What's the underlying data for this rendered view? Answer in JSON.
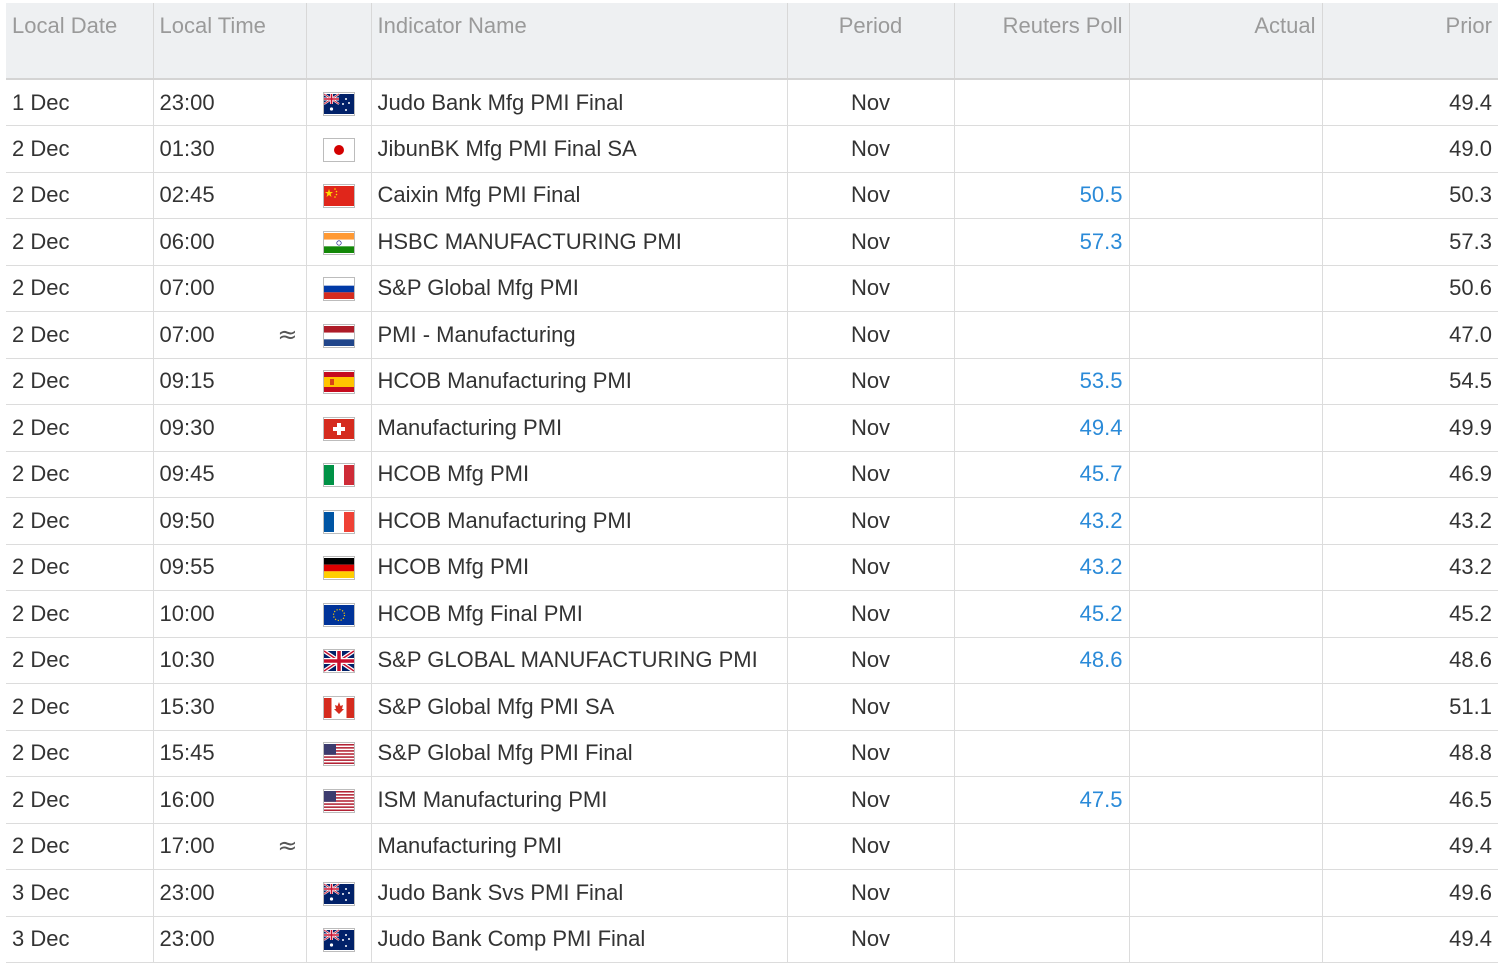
{
  "headers": {
    "date": "Local Date",
    "time": "Local Time",
    "flag": "",
    "name": "Indicator Name",
    "period": "Period",
    "poll": "Reuters Poll",
    "actual": "Actual",
    "prior": "Prior"
  },
  "colors": {
    "poll_value": "#2a8ad8",
    "header_bg": "#eef0f2",
    "header_text": "#9a9a9a"
  },
  "rows": [
    {
      "date": "1 Dec",
      "time": "23:00",
      "approx": "",
      "flag": "flag-australia-icon",
      "name": "Judo Bank Mfg PMI Final",
      "period": "Nov",
      "poll": "",
      "actual": "",
      "prior": "49.4"
    },
    {
      "date": "2 Dec",
      "time": "01:30",
      "approx": "",
      "flag": "flag-japan-icon",
      "name": "JibunBK Mfg PMI Final SA",
      "period": "Nov",
      "poll": "",
      "actual": "",
      "prior": "49.0"
    },
    {
      "date": "2 Dec",
      "time": "02:45",
      "approx": "",
      "flag": "flag-china-icon",
      "name": "Caixin Mfg PMI Final",
      "period": "Nov",
      "poll": "50.5",
      "actual": "",
      "prior": "50.3"
    },
    {
      "date": "2 Dec",
      "time": "06:00",
      "approx": "",
      "flag": "flag-india-icon",
      "name": "HSBC MANUFACTURING PMI",
      "period": "Nov",
      "poll": "57.3",
      "actual": "",
      "prior": "57.3"
    },
    {
      "date": "2 Dec",
      "time": "07:00",
      "approx": "",
      "flag": "flag-russia-icon",
      "name": "S&P Global Mfg PMI",
      "period": "Nov",
      "poll": "",
      "actual": "",
      "prior": "50.6"
    },
    {
      "date": "2 Dec",
      "time": "07:00",
      "approx": "≈",
      "flag": "flag-netherlands-icon",
      "name": "PMI - Manufacturing",
      "period": "Nov",
      "poll": "",
      "actual": "",
      "prior": "47.0"
    },
    {
      "date": "2 Dec",
      "time": "09:15",
      "approx": "",
      "flag": "flag-spain-icon",
      "name": "HCOB Manufacturing PMI",
      "period": "Nov",
      "poll": "53.5",
      "actual": "",
      "prior": "54.5"
    },
    {
      "date": "2 Dec",
      "time": "09:30",
      "approx": "",
      "flag": "flag-switzerland-icon",
      "name": "Manufacturing PMI",
      "period": "Nov",
      "poll": "49.4",
      "actual": "",
      "prior": "49.9"
    },
    {
      "date": "2 Dec",
      "time": "09:45",
      "approx": "",
      "flag": "flag-italy-icon",
      "name": "HCOB Mfg PMI",
      "period": "Nov",
      "poll": "45.7",
      "actual": "",
      "prior": "46.9"
    },
    {
      "date": "2 Dec",
      "time": "09:50",
      "approx": "",
      "flag": "flag-france-icon",
      "name": "HCOB Manufacturing PMI",
      "period": "Nov",
      "poll": "43.2",
      "actual": "",
      "prior": "43.2"
    },
    {
      "date": "2 Dec",
      "time": "09:55",
      "approx": "",
      "flag": "flag-germany-icon",
      "name": "HCOB Mfg PMI",
      "period": "Nov",
      "poll": "43.2",
      "actual": "",
      "prior": "43.2"
    },
    {
      "date": "2 Dec",
      "time": "10:00",
      "approx": "",
      "flag": "flag-eu-icon",
      "name": "HCOB Mfg Final PMI",
      "period": "Nov",
      "poll": "45.2",
      "actual": "",
      "prior": "45.2"
    },
    {
      "date": "2 Dec",
      "time": "10:30",
      "approx": "",
      "flag": "flag-uk-icon",
      "name": "S&P GLOBAL MANUFACTURING PMI",
      "period": "Nov",
      "poll": "48.6",
      "actual": "",
      "prior": "48.6"
    },
    {
      "date": "2 Dec",
      "time": "15:30",
      "approx": "",
      "flag": "flag-canada-icon",
      "name": "S&P Global Mfg PMI SA",
      "period": "Nov",
      "poll": "",
      "actual": "",
      "prior": "51.1"
    },
    {
      "date": "2 Dec",
      "time": "15:45",
      "approx": "",
      "flag": "flag-usa-icon",
      "name": "S&P Global Mfg PMI Final",
      "period": "Nov",
      "poll": "",
      "actual": "",
      "prior": "48.8"
    },
    {
      "date": "2 Dec",
      "time": "16:00",
      "approx": "",
      "flag": "flag-usa-icon",
      "name": "ISM Manufacturing PMI",
      "period": "Nov",
      "poll": "47.5",
      "actual": "",
      "prior": "46.5"
    },
    {
      "date": "2 Dec",
      "time": "17:00",
      "approx": "≈",
      "flag": "",
      "name": "Manufacturing PMI",
      "period": "Nov",
      "poll": "",
      "actual": "",
      "prior": "49.4"
    },
    {
      "date": "3 Dec",
      "time": "23:00",
      "approx": "",
      "flag": "flag-australia-icon",
      "name": "Judo Bank Svs PMI Final",
      "period": "Nov",
      "poll": "",
      "actual": "",
      "prior": "49.6"
    },
    {
      "date": "3 Dec",
      "time": "23:00",
      "approx": "",
      "flag": "flag-australia-icon",
      "name": "Judo Bank Comp PMI Final",
      "period": "Nov",
      "poll": "",
      "actual": "",
      "prior": "49.4"
    }
  ]
}
